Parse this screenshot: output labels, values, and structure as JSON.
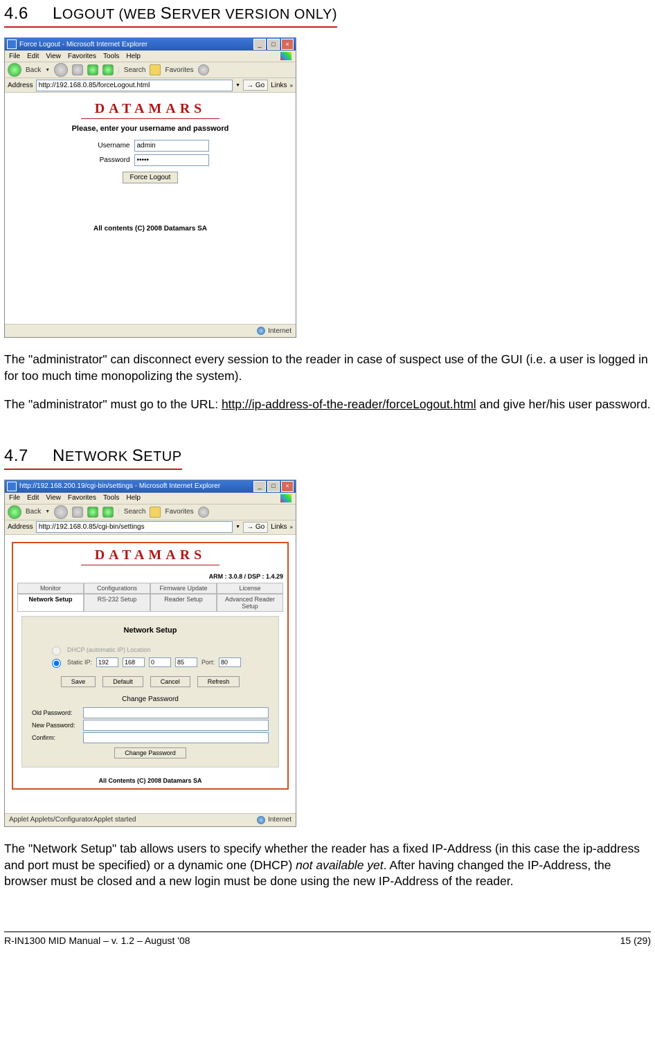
{
  "section1": {
    "num": "4.6",
    "title_pre": "L",
    "title_rest": "OGOUT (W",
    "title_mid": "EB ",
    "title_mid2": "S",
    "title_rest2": "ERVER VERSION ONLY)"
  },
  "section2": {
    "num": "4.7",
    "title_pre": "N",
    "title_rest": "ETWORK ",
    "title_mid": "S",
    "title_rest2": "ETUP"
  },
  "shot1": {
    "window_title": "Force Logout - Microsoft Internet Explorer",
    "menu": [
      "File",
      "Edit",
      "View",
      "Favorites",
      "Tools",
      "Help"
    ],
    "toolbar": {
      "back": "Back",
      "search": "Search",
      "favorites": "Favorites"
    },
    "addr_label": "Address",
    "addr_value": "http://192.168.0.85/forceLogout.html",
    "go": "Go",
    "links": "Links",
    "logo": "DATAMARS",
    "prompt": "Please, enter your username and password",
    "u_label": "Username",
    "u_value": "admin",
    "p_label": "Password",
    "p_value": "•••••",
    "btn": "Force Logout",
    "copyright": "All contents (C) 2008 Datamars SA",
    "status": "Internet"
  },
  "para1": "The \"administrator\" can disconnect every session to the reader in case of suspect use of the GUI (i.e. a user is logged in for too much time monopolizing the system).",
  "para2_a": "The \"administrator\" must go to the URL: ",
  "para2_url": "http://ip-address-of-the-reader/forceLogout.html",
  "para2_b": " and give her/his user password.",
  "shot2": {
    "window_title": "http://192.168.200.19/cgi-bin/settings - Microsoft Internet Explorer",
    "menu": [
      "File",
      "Edit",
      "View",
      "Favorites",
      "Tools",
      "Help"
    ],
    "toolbar": {
      "back": "Back",
      "search": "Search",
      "favorites": "Favorites"
    },
    "addr_label": "Address",
    "addr_value": "http://192.168.0.85/cgi-bin/settings",
    "go": "Go",
    "links": "Links",
    "logo": "DATAMARS",
    "version": "ARM : 3.0.8 / DSP : 1.4.29",
    "tabs_row1": [
      "Monitor",
      "Configurations",
      "Firmware Update",
      "License"
    ],
    "tabs_row2": [
      "Network Setup",
      "RS-232 Setup",
      "Reader Setup",
      "Advanced Reader Setup"
    ],
    "active_tab": "Network Setup",
    "panel_title": "Network Setup",
    "dhcp_label": "DHCP (automatic IP) Location",
    "static_label": "Static IP:",
    "ip": [
      "192",
      "168",
      "0",
      "85"
    ],
    "port_label": "Port:",
    "port": "80",
    "btns": [
      "Save",
      "Default",
      "Cancel",
      "Refresh"
    ],
    "pw_title": "Change Password",
    "pw_labels": [
      "Old Password:",
      "New Password:",
      "Confirm:"
    ],
    "pw_btn": "Change Password",
    "copyright": "All Contents (C) 2008 Datamars SA",
    "status_left": "Applet Applets/ConfiguratorApplet started",
    "status_right": "Internet"
  },
  "para3_a": "The \"Network Setup\" tab allows users to specify whether the reader has a fixed IP-Address (in this case the ip-address and port must be specified) or a dynamic one (DHCP) ",
  "para3_i": "not available yet",
  "para3_b": ".  After having changed the IP-Address, the browser must be closed and a new login must be done using the new IP-Address of the reader.",
  "footer": {
    "left": "R-IN1300 MID Manual  – v. 1.2 – August '08",
    "right": "15 (29)"
  }
}
